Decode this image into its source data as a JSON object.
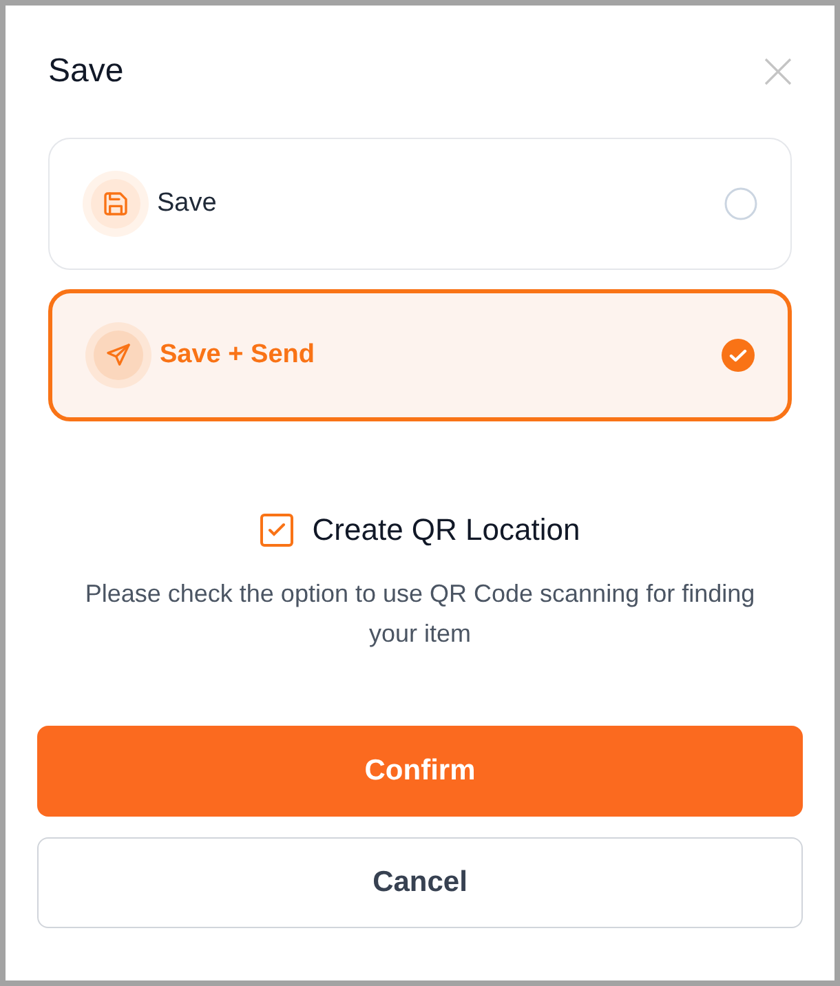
{
  "dialog": {
    "title": "Save"
  },
  "options": [
    {
      "kind": "save",
      "label": "Save",
      "selected": false
    },
    {
      "kind": "send",
      "label": "Save + Send",
      "selected": true
    }
  ],
  "qr_option": {
    "label": "Create QR Location",
    "checked": true
  },
  "hint": "Please check the option to use QR Code scanning for finding your item",
  "buttons": [
    {
      "kind": "primary",
      "label": "Confirm"
    },
    {
      "kind": "secondary",
      "label": "Cancel"
    }
  ]
}
